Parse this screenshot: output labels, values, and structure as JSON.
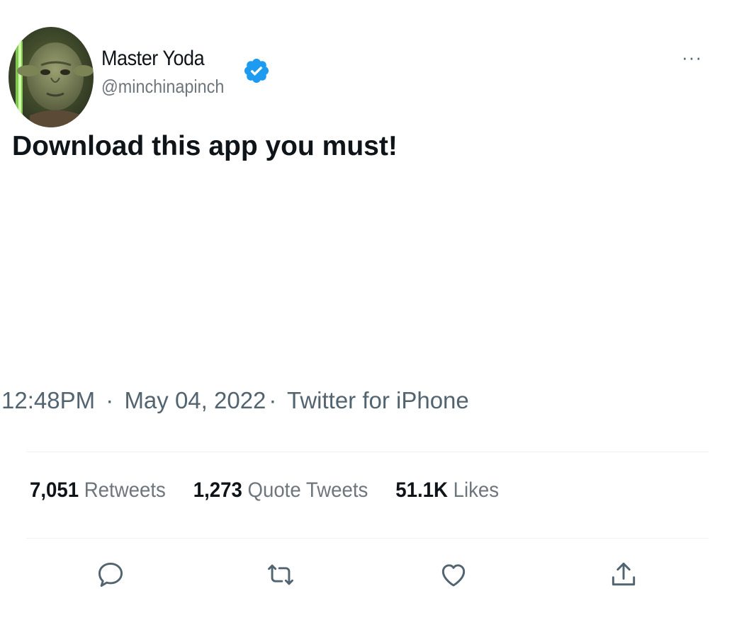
{
  "author": {
    "name": "Master Yoda",
    "handle": "@minchinapinch",
    "verified": true
  },
  "tweet": {
    "text": "Download this app you must!",
    "time": "12:48PM",
    "separator": "·",
    "date": "May 04, 2022",
    "source": "Twitter for iPhone"
  },
  "more_label": "···",
  "stats": {
    "retweets": {
      "value": "7,051",
      "label": "Retweets"
    },
    "quotes": {
      "value": "1,273",
      "label": "Quote Tweets"
    },
    "likes": {
      "value": "51.1K",
      "label": "Likes"
    }
  },
  "actions": [
    "reply-icon",
    "retweet-icon",
    "like-icon",
    "share-icon"
  ],
  "colors": {
    "verified_blue": "#1d9bf0",
    "secondary_text": "#536471",
    "primary_text": "#0f1419",
    "divider": "#eff3f4"
  }
}
